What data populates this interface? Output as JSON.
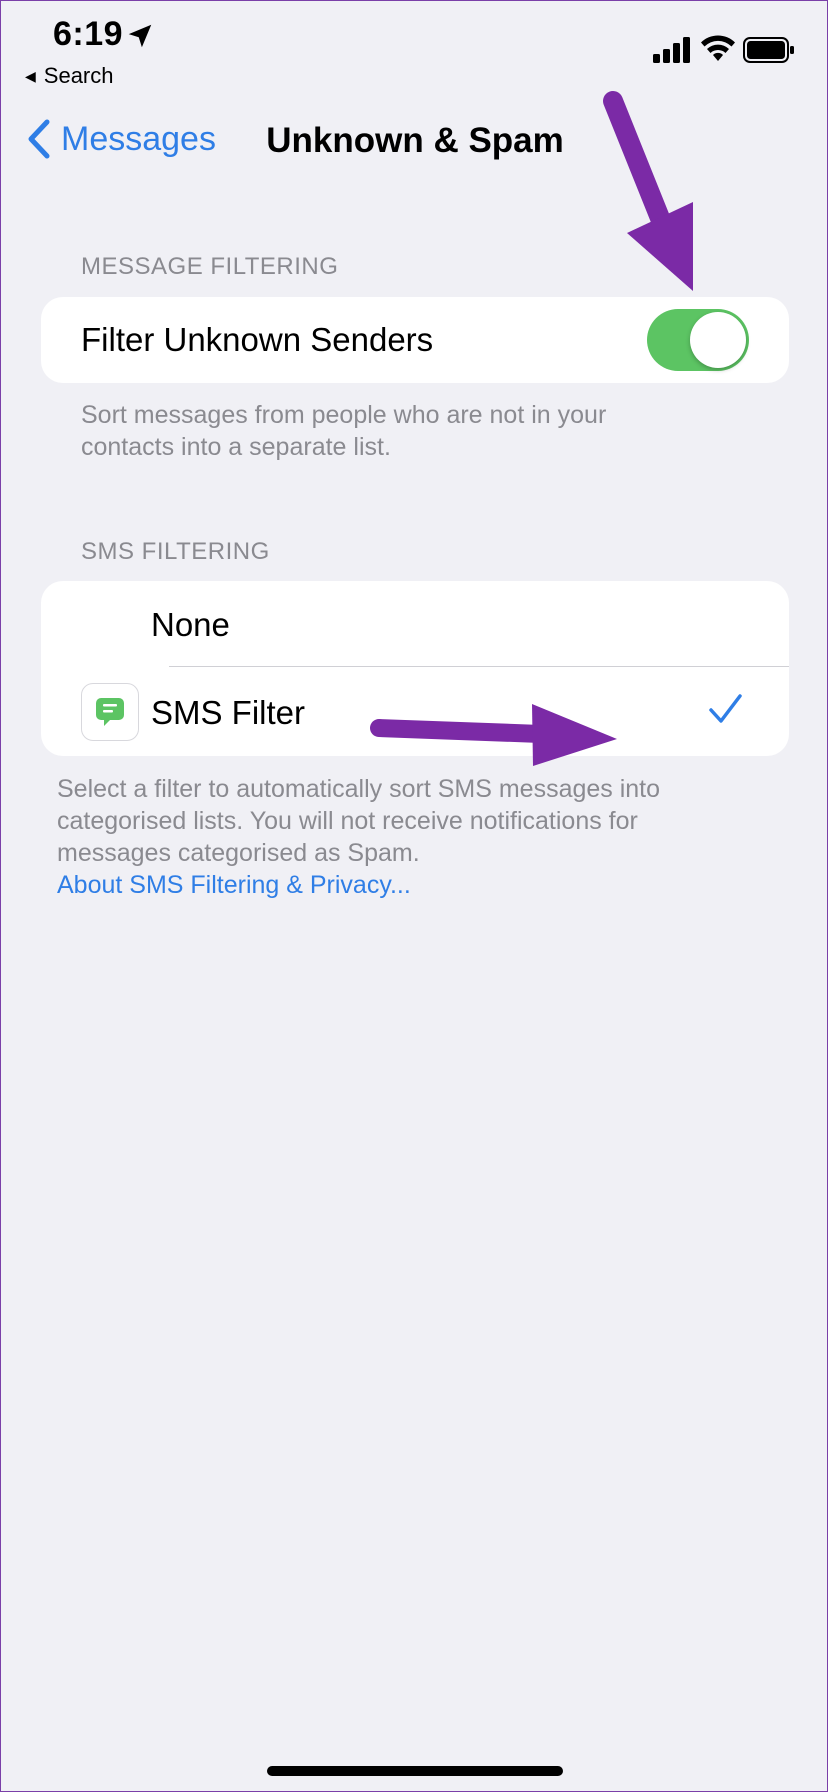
{
  "status_bar": {
    "time": "6:19",
    "back_app": "Search",
    "icons": [
      "location-arrow-icon",
      "signal-icon",
      "wifi-icon",
      "battery-icon"
    ]
  },
  "nav": {
    "back_label": "Messages",
    "title": "Unknown & Spam"
  },
  "message_filtering": {
    "header": "MESSAGE FILTERING",
    "row_label": "Filter Unknown Senders",
    "toggle_on": true,
    "footer_line1": "Sort messages from people who are not in your",
    "footer_line2": "contacts into a separate list."
  },
  "sms_filtering": {
    "header": "SMS FILTERING",
    "options": [
      {
        "label": "None",
        "selected": false
      },
      {
        "label": "SMS Filter",
        "selected": true
      }
    ],
    "footer_line1": "Select a filter to automatically sort SMS messages into",
    "footer_line2": "categorised lists. You will not receive notifications for",
    "footer_line3": "messages categorised as Spam.",
    "link": "About SMS Filtering & Privacy..."
  },
  "colors": {
    "accent": "#2f7ee6",
    "toggle_on": "#5cc463",
    "annotation_arrow": "#7b2aa6",
    "background": "#f0f0f5"
  }
}
